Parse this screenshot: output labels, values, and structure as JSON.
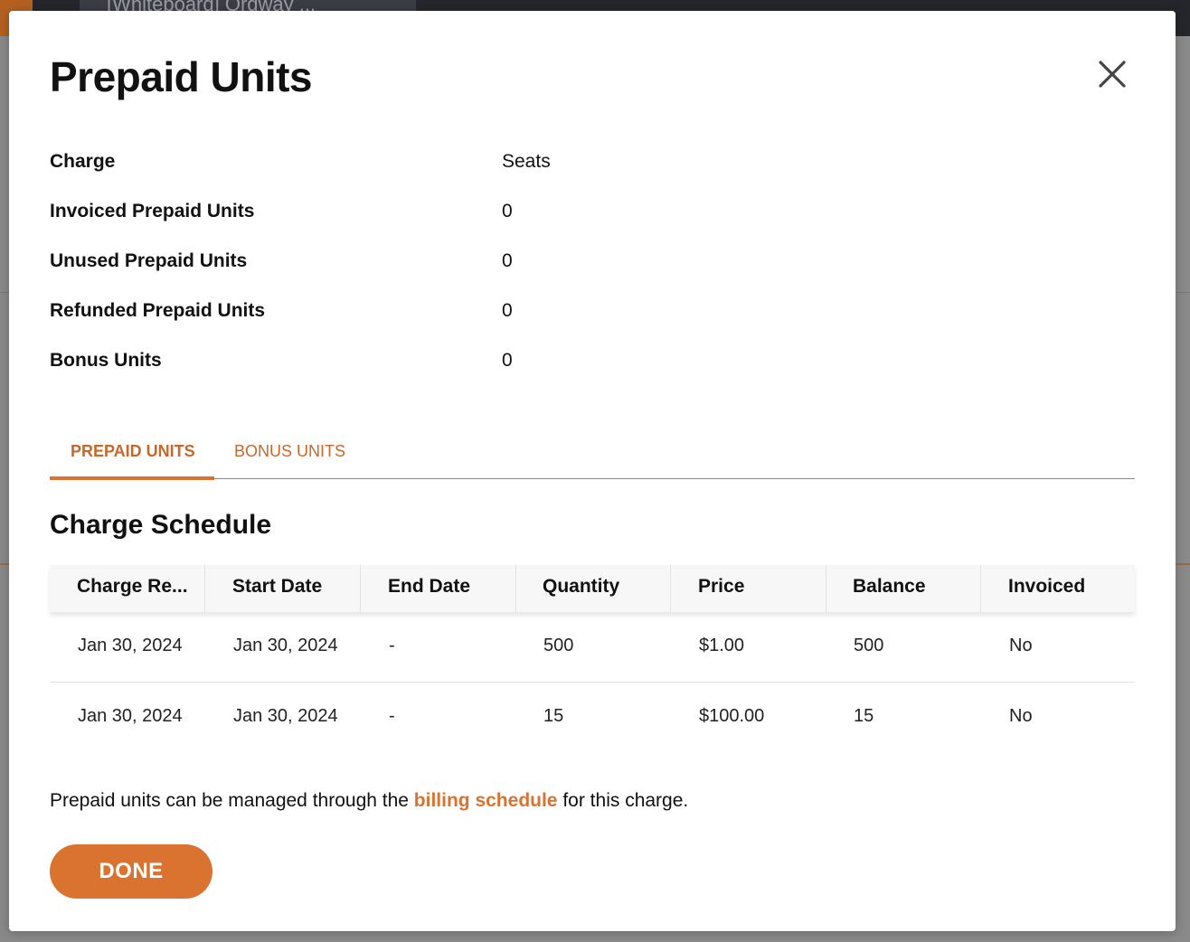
{
  "background": {
    "tab_title": "[Whiteboard] Ordway ..."
  },
  "modal": {
    "title": "Prepaid Units",
    "close_icon": "close-icon",
    "info": [
      {
        "label": "Charge",
        "value": "Seats"
      },
      {
        "label": "Invoiced Prepaid Units",
        "value": "0"
      },
      {
        "label": "Unused Prepaid Units",
        "value": "0"
      },
      {
        "label": "Refunded Prepaid Units",
        "value": "0"
      },
      {
        "label": "Bonus Units",
        "value": "0"
      }
    ],
    "tabs": [
      {
        "label": "PREPAID UNITS",
        "active": true
      },
      {
        "label": "BONUS UNITS",
        "active": false
      }
    ],
    "section_title": "Charge Schedule",
    "table": {
      "columns": [
        "Charge Re...",
        "Start Date",
        "End Date",
        "Quantity",
        "Price",
        "Balance",
        "Invoiced"
      ],
      "rows": [
        [
          "Jan 30, 2024",
          "Jan 30, 2024",
          "-",
          "500",
          "$1.00",
          "500",
          "No"
        ],
        [
          "Jan 30, 2024",
          "Jan 30, 2024",
          "-",
          "15",
          "$100.00",
          "15",
          "No"
        ]
      ]
    },
    "footer": {
      "text_before": "Prepaid units can be managed through the ",
      "link": "billing schedule",
      "text_after": " for this charge."
    },
    "done_label": "DONE"
  },
  "colors": {
    "accent": "#d9732f",
    "topbar": "#24262b",
    "overlay": "#8a8a8a"
  }
}
